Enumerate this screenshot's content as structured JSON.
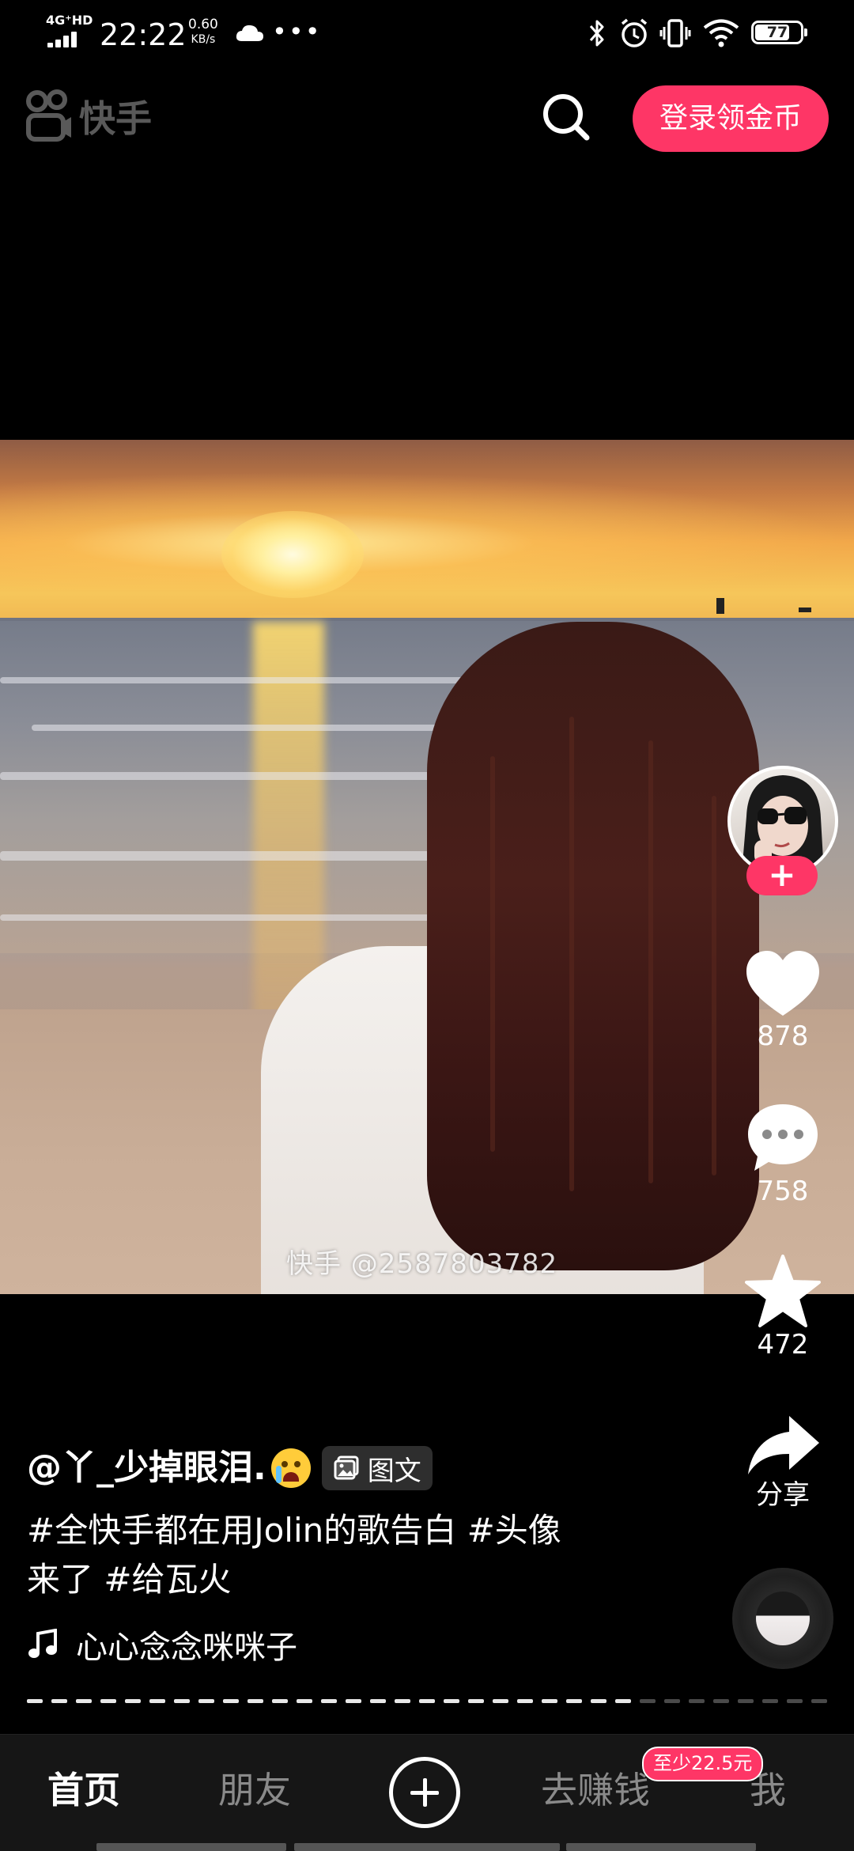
{
  "status_bar": {
    "network": "4G⁺HD",
    "time": "22:22",
    "speed_value": "0.60",
    "speed_unit": "KB/s",
    "dots": "•••",
    "battery": "77",
    "battery_level": 0.77
  },
  "header": {
    "logo_text": "快手",
    "login_label": "登录领金币"
  },
  "video": {
    "watermark": "快手 @2587803782"
  },
  "actions": {
    "likes": "878",
    "comments": "758",
    "favorites": "472",
    "share_label": "分享",
    "follow_symbol": "+"
  },
  "post": {
    "author": "@丫_少掉眼泪.",
    "type_badge": "图文",
    "caption_line1": "#全快手都在用Jolin的歌告白 #头像",
    "caption_line2": "来了 #给瓦火",
    "music_title": "心心念念咪咪子",
    "progress": 0.75
  },
  "bottom_nav": {
    "home": "首页",
    "friends": "朋友",
    "earn": "去赚钱",
    "me": "我",
    "earn_badge": "至少22.5元"
  },
  "colors": {
    "accent": "#fe3666",
    "background": "#000000",
    "nav_background": "#161616"
  }
}
